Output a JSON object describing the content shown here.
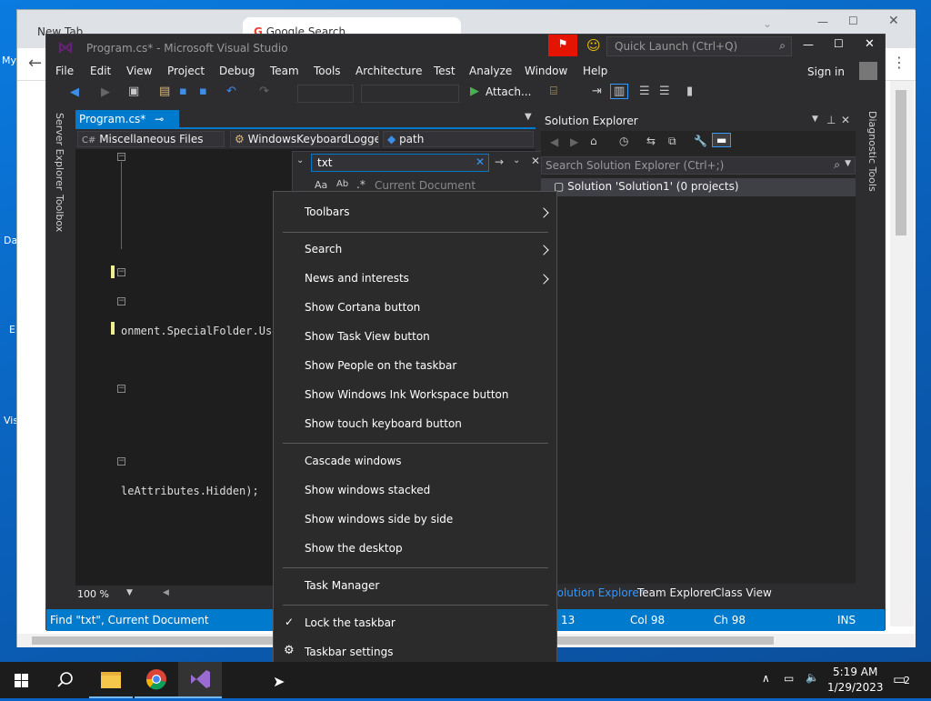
{
  "desktop": {
    "icons": [
      "My",
      "Da",
      "E",
      "Vis"
    ]
  },
  "chrome": {
    "tabs": [
      "New Tab",
      "Google Search"
    ]
  },
  "vs": {
    "title": "Program.cs* - Microsoft Visual Studio",
    "quick_launch": "Quick Launch (Ctrl+Q)",
    "sign_in": "Sign in",
    "menu": [
      "File",
      "Edit",
      "View",
      "Project",
      "Debug",
      "Team",
      "Tools",
      "Architecture",
      "Test",
      "Analyze",
      "Window",
      "Help"
    ],
    "attach": "Attach...",
    "left_strip": [
      "Server Explorer",
      "Toolbox"
    ],
    "doc_tab": "Program.cs*",
    "nav": {
      "project": "Miscellaneous Files",
      "type": "WindowsKeyboardLogge",
      "member": "path"
    },
    "find": {
      "query": "txt",
      "scope": "Current Document"
    },
    "code": {
      "line1": "onment.SpecialFolder.Use",
      "line2": "leAttributes.Hidden);"
    },
    "zoom": "100 %",
    "solution_explorer": {
      "title": "Solution Explorer",
      "search": "Search Solution Explorer (Ctrl+;)",
      "solution": "Solution 'Solution1' (0 projects)",
      "tabs": [
        "Solution Explorer",
        "Team Explorer",
        "Class View"
      ]
    },
    "right_strip": "Diagnostic Tools",
    "status": {
      "message": "Find \"txt\", Current Document",
      "ln": "13",
      "col": "Col 98",
      "ch": "Ch 98",
      "mode": "INS"
    }
  },
  "context_menu": {
    "items": [
      {
        "label": "Toolbars",
        "submenu": true
      },
      {
        "label": "Search",
        "submenu": true
      },
      {
        "label": "News and interests",
        "submenu": true
      },
      {
        "label": "Show Cortana button"
      },
      {
        "label": "Show Task View button"
      },
      {
        "label": "Show People on the taskbar"
      },
      {
        "label": "Show Windows Ink Workspace button"
      },
      {
        "label": "Show touch keyboard button"
      },
      {
        "label": "Cascade windows"
      },
      {
        "label": "Show windows stacked"
      },
      {
        "label": "Show windows side by side"
      },
      {
        "label": "Show the desktop"
      },
      {
        "label": "Task Manager"
      },
      {
        "label": "Lock the taskbar",
        "checked": true
      },
      {
        "label": "Taskbar settings",
        "icon": "gear-icon"
      }
    ]
  },
  "taskbar": {
    "time": "5:19 AM",
    "date": "1/29/2023",
    "notifications": "2"
  },
  "colors": {
    "vs_accent": "#007acc",
    "vs_bg": "#2d2d30",
    "menu_bg": "#2b2b2b",
    "taskbar_bg": "#1c1c1c"
  }
}
